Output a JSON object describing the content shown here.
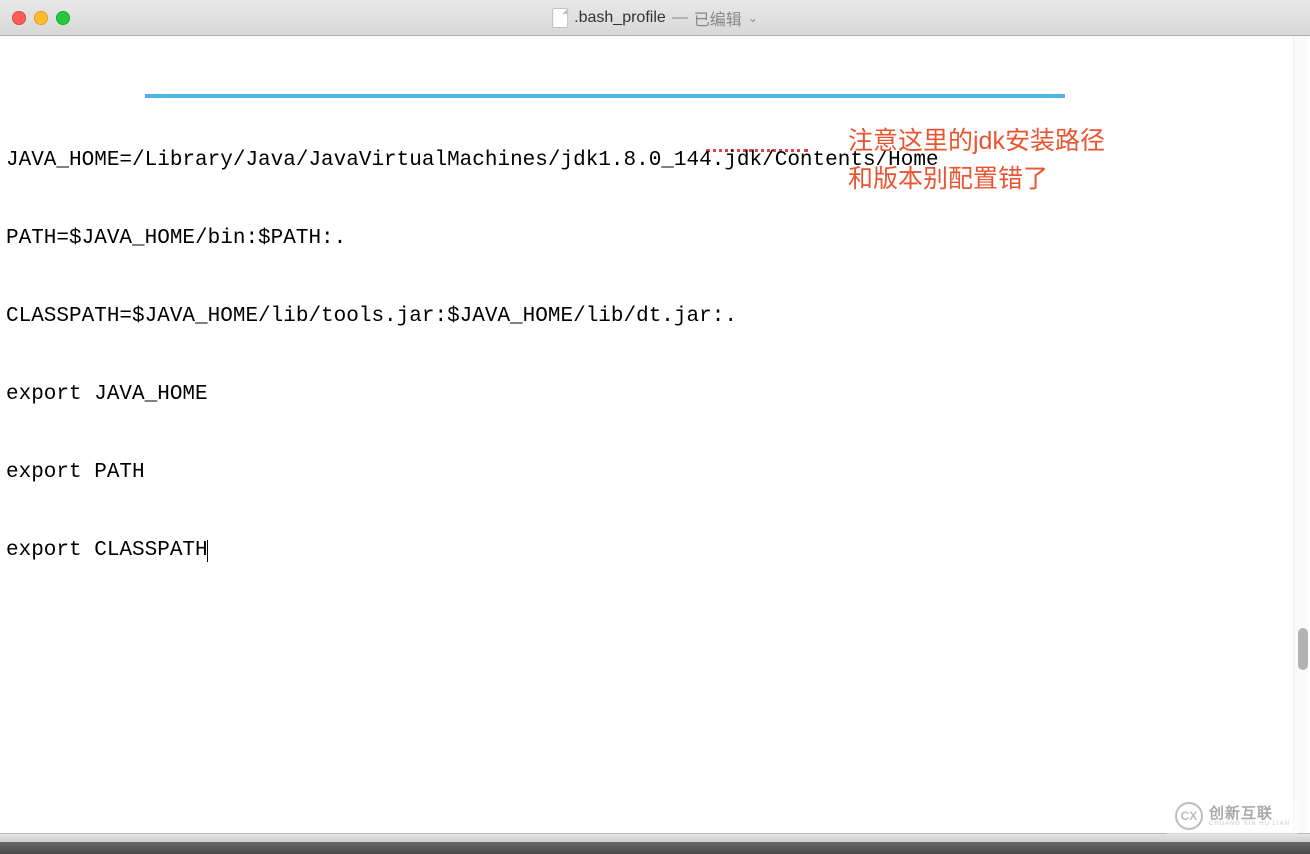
{
  "window": {
    "filename": ".bash_profile",
    "status_separator": "—",
    "status_text": "已编辑",
    "chevron": "⌄"
  },
  "code": {
    "line1": "JAVA_HOME=/Library/Java/JavaVirtualMachines/jdk1.8.0_144.jdk/Contents/Home",
    "line2": "PATH=$JAVA_HOME/bin:$PATH:.",
    "line3": "CLASSPATH=$JAVA_HOME/lib/tools.jar:$JAVA_HOME/lib/dt.jar:.",
    "line4": "export JAVA_HOME",
    "line5": "export PATH",
    "line6": "export CLASSPATH"
  },
  "annotation": {
    "line1": "注意这里的jdk安装路径",
    "line2": "和版本别配置错了"
  },
  "watermark": {
    "main": "创新互联",
    "sub": "CHUANG XIN HU LIAN",
    "logo_text": "CX"
  }
}
